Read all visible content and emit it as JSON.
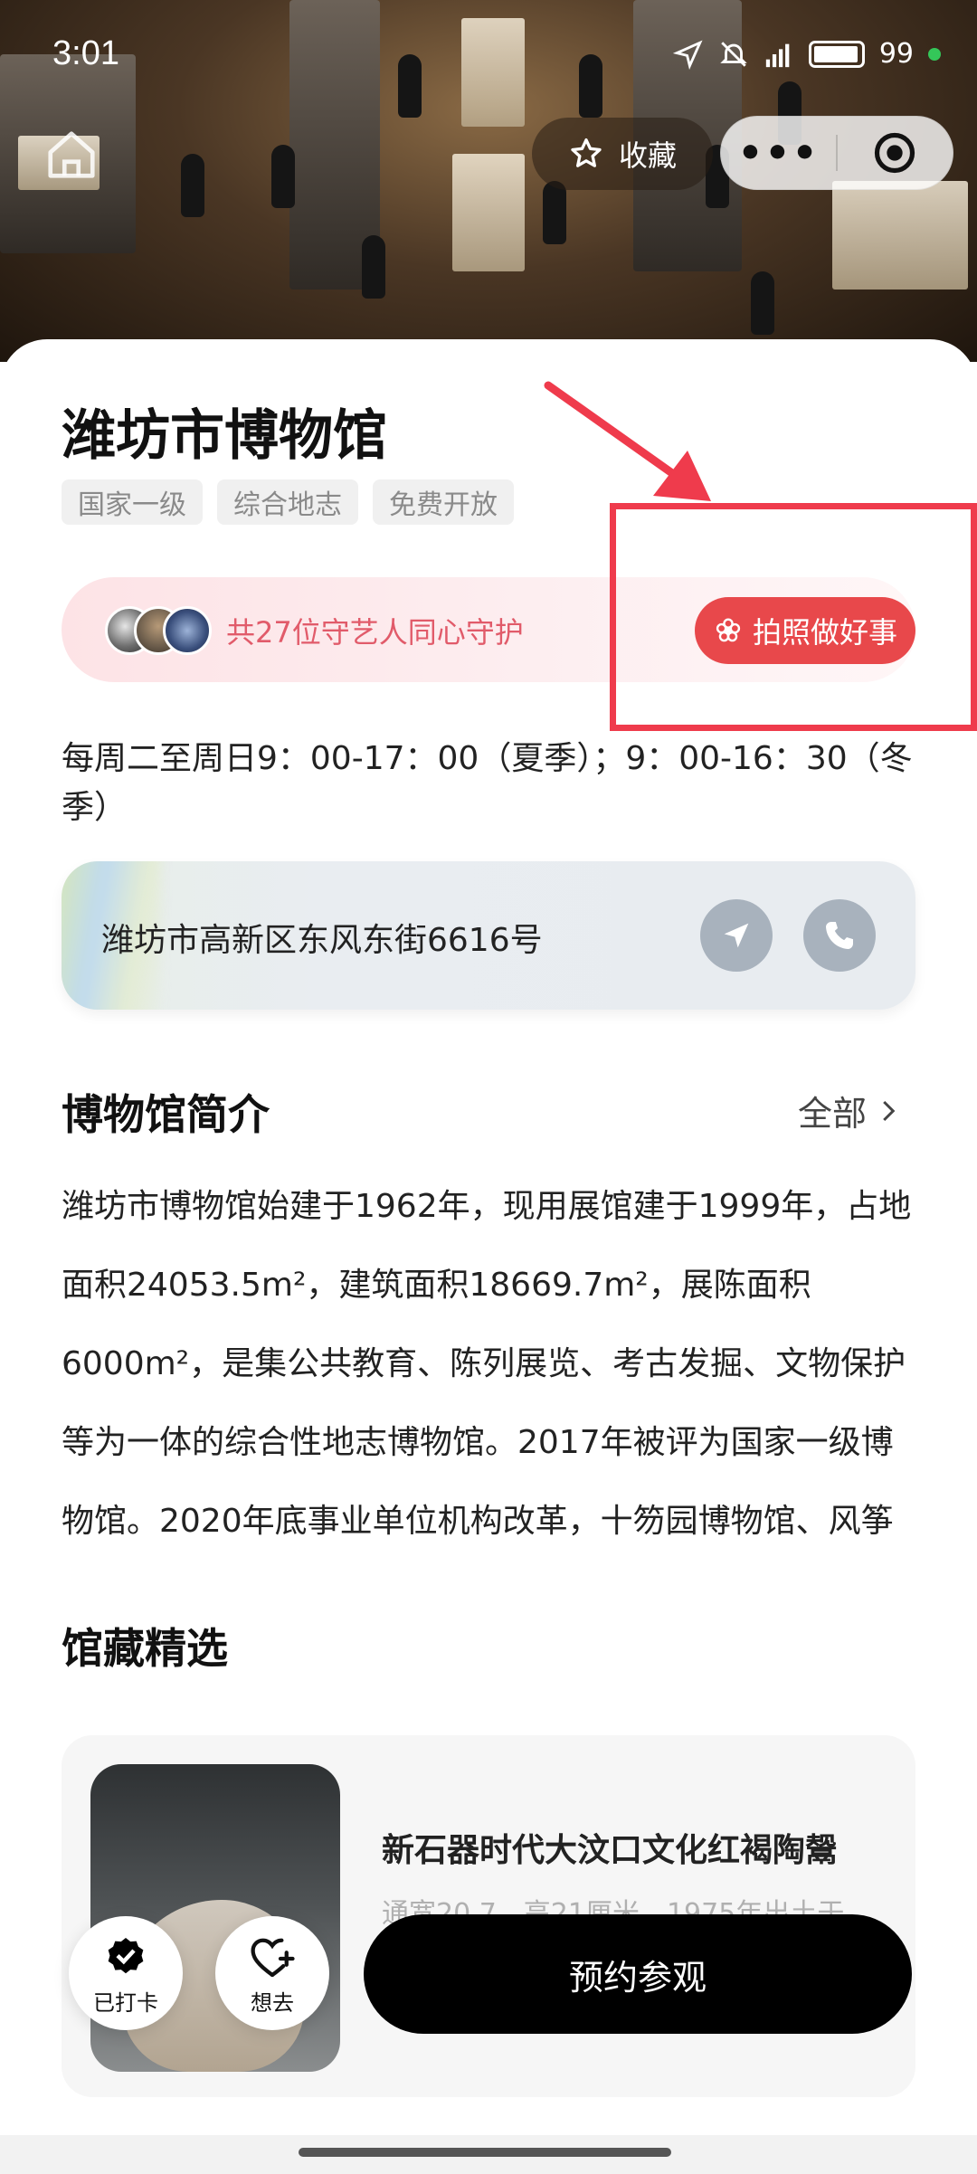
{
  "status": {
    "time": "3:01",
    "battery": "99"
  },
  "top": {
    "favorite_label": "收藏",
    "more_label": "•••"
  },
  "museum": {
    "name": "潍坊市博物馆",
    "tags": [
      "国家一级",
      "综合地志",
      "免费开放"
    ],
    "guardians_text": "共27位守艺人同心守护",
    "photo_button": "拍照做好事",
    "hours": "每周二至周日9：00-17：00（夏季）；9：00-16：30（冬季）",
    "address": "潍坊市高新区东风东街6616号"
  },
  "intro": {
    "title": "博物馆简介",
    "all_label": "全部",
    "text": "潍坊市博物馆始建于1962年，现用展馆建于1999年，占地面积24053.5m²，建筑面积18669.7m²，展陈面积6000m²，是集公共教育、陈列展览、考古发掘、文物保护等为一体的综合性地志博物馆。2017年被评为国家一级博物馆。2020年底事业单位机构改革，十笏园博物馆、风筝"
  },
  "collection": {
    "title": "馆藏精选",
    "item_title": "新石器时代大汶口文化红褐陶鬶",
    "item_sub": "通宽20.7，高21厘米，1975年出土于"
  },
  "bottom": {
    "checked_in": "已打卡",
    "want_to_go": "想去",
    "book_button": "预约参观"
  },
  "colors": {
    "accent_red": "#e8484b",
    "annotation_red": "#ef3b4c",
    "primary_black": "#000000"
  },
  "icons": [
    "home-icon",
    "star-icon",
    "more-dots-icon",
    "target-icon",
    "flower-icon",
    "navigate-icon",
    "phone-icon",
    "chevron-right-icon",
    "check-badge-icon",
    "heart-plus-icon"
  ]
}
